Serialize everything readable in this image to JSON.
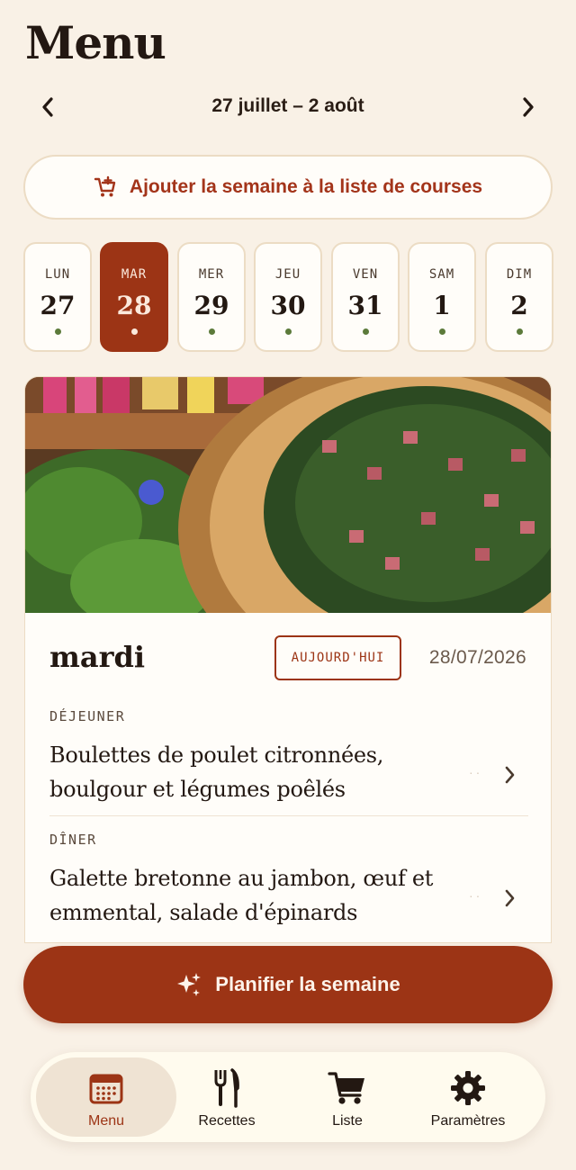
{
  "header": {
    "title": "Menu"
  },
  "week_nav": {
    "label": "27 juillet – 2 août",
    "prev_icon": "chevron-left-icon",
    "next_icon": "chevron-right-icon"
  },
  "add_week_button": {
    "label": "Ajouter la semaine à la liste de courses",
    "icon": "cart-plus-icon"
  },
  "days": [
    {
      "name": "LUN",
      "number": "27",
      "selected": false
    },
    {
      "name": "MAR",
      "number": "28",
      "selected": true
    },
    {
      "name": "MER",
      "number": "29",
      "selected": false
    },
    {
      "name": "JEU",
      "number": "30",
      "selected": false
    },
    {
      "name": "VEN",
      "number": "31",
      "selected": false
    },
    {
      "name": "SAM",
      "number": "1",
      "selected": false
    },
    {
      "name": "DIM",
      "number": "2",
      "selected": false
    }
  ],
  "day_card": {
    "day_name": "mardi",
    "badge": "AUJOURD'HUI",
    "date": "28/07/2026",
    "meals": [
      {
        "label": "DÉJEUNER",
        "title": "Boulettes de poulet citronnées, boulgour et légumes poêlés"
      },
      {
        "label": "DÎNER",
        "title": "Galette bretonne au jambon, œuf et emmental, salade d'épinards"
      }
    ]
  },
  "plan_button": {
    "label": "Planifier la semaine",
    "icon": "sparkles-icon"
  },
  "tabbar": {
    "tabs": [
      {
        "label": "Menu",
        "icon": "calendar-icon",
        "active": true
      },
      {
        "label": "Recettes",
        "icon": "fork-knife-icon",
        "active": false
      },
      {
        "label": "Liste",
        "icon": "cart-icon",
        "active": false
      },
      {
        "label": "Paramètres",
        "icon": "gear-icon",
        "active": false
      }
    ]
  },
  "colors": {
    "background": "#f9f1e6",
    "accent": "#9c3415",
    "dot_green": "#5c7a3a",
    "text": "#231812"
  }
}
